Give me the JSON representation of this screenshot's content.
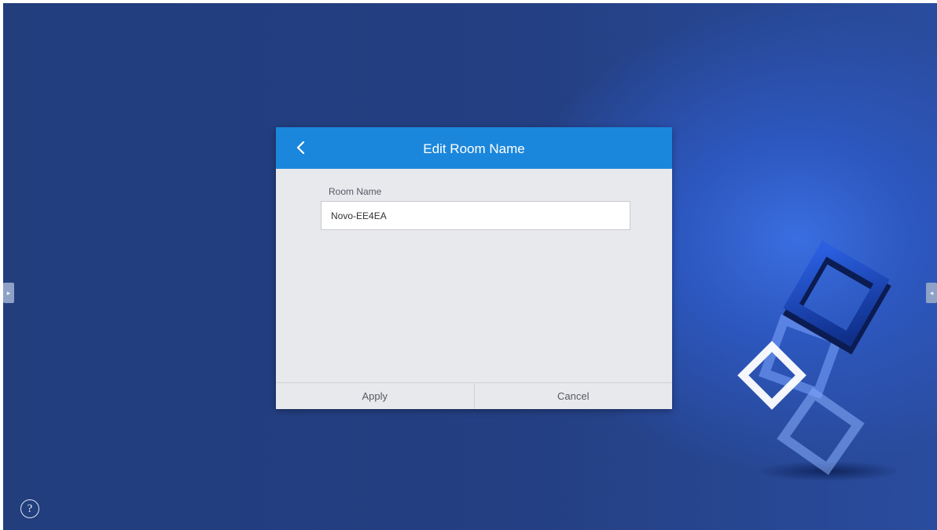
{
  "dialog": {
    "title": "Edit Room Name",
    "back_icon": "chevron-left-icon",
    "field_label": "Room Name",
    "field_value": "Novo-EE4EA",
    "apply_label": "Apply",
    "cancel_label": "Cancel"
  },
  "screen": {
    "help_symbol": "?",
    "left_tab_icon": "chevron-right-icon",
    "right_tab_icon": "chevron-left-icon"
  },
  "colors": {
    "header": "#1b87dc",
    "background": "#243f82",
    "dialog_body": "#e8e9ed"
  }
}
